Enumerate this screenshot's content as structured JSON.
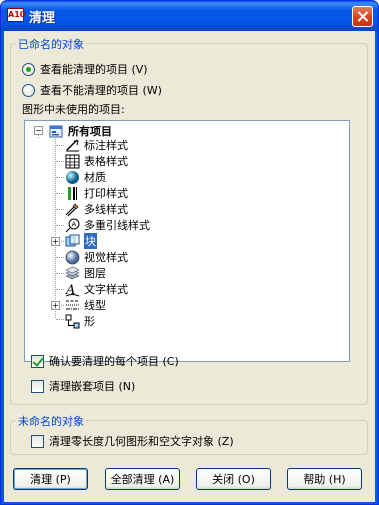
{
  "window": {
    "title": "清理",
    "app_icon_text": "A10"
  },
  "named_group": {
    "title": "已命名的对象",
    "radio_can_purge": "查看能清理的项目 (V)",
    "radio_cannot_purge": "查看不能清理的项目 (W)",
    "tree_caption": "图形中未使用的项目:"
  },
  "tree": {
    "root": "所有项目",
    "items": [
      {
        "label": "标注样式",
        "icon": "dimension-style-icon"
      },
      {
        "label": "表格样式",
        "icon": "table-style-icon"
      },
      {
        "label": "材质",
        "icon": "material-icon"
      },
      {
        "label": "打印样式",
        "icon": "plot-style-icon"
      },
      {
        "label": "多线样式",
        "icon": "multiline-style-icon"
      },
      {
        "label": "多重引线样式",
        "icon": "multileader-style-icon"
      },
      {
        "label": "块",
        "icon": "block-icon",
        "expandable": true,
        "selected": true
      },
      {
        "label": "视觉样式",
        "icon": "visual-style-icon"
      },
      {
        "label": "图层",
        "icon": "layer-icon"
      },
      {
        "label": "文字样式",
        "icon": "text-style-icon"
      },
      {
        "label": "线型",
        "icon": "linetype-icon",
        "expandable": true
      },
      {
        "label": "形",
        "icon": "shape-icon"
      }
    ]
  },
  "options": {
    "confirm_each": "确认要清理的每个项目 (C)",
    "purge_nested": "清理嵌套项目 (N)"
  },
  "unnamed_group": {
    "title": "未命名的对象",
    "zero_length": "清理零长度几何图形和空文字对象 (Z)"
  },
  "buttons": {
    "purge": "清理 (P)",
    "purge_all": "全部清理 (A)",
    "close": "关闭 (O)",
    "help": "帮助 (H)"
  }
}
